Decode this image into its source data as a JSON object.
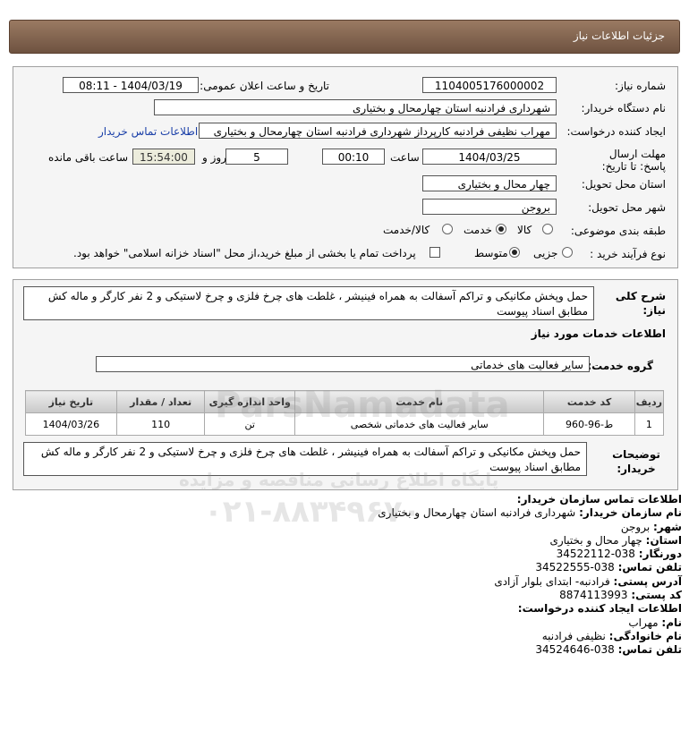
{
  "header": {
    "title": "جزئیات اطلاعات نیاز"
  },
  "form": {
    "need_number_label": "شماره نیاز:",
    "need_number": "1104005176000002",
    "announce_label": "تاریخ و ساعت اعلان عمومی:",
    "announce_value": "1404/03/19 - 08:11",
    "buyer_org_label": "نام دستگاه خریدار:",
    "buyer_org": "شهرداری فرادنبه استان چهارمحال و بختیاری",
    "creator_label": "ایجاد کننده درخواست:",
    "creator": "مهراب نظیفی فرادنبه کارپرداز شهرداری فرادنبه استان چهارمحال و بختیاری",
    "buyer_contact_link": "اطلاعات تماس خریدار",
    "deadline_label": "مهلت ارسال پاسخ: تا تاریخ:",
    "deadline_date": "1404/03/25",
    "time_label": "ساعت",
    "deadline_time": "00:10",
    "days_value": "5",
    "days_label": "روز و",
    "remaining_time": "15:54:00",
    "remaining_label": "ساعت باقی مانده",
    "province_label": "استان محل تحویل:",
    "province": "چهار محال و بختیاری",
    "city_label": "شهر محل تحویل:",
    "city": "بروجن",
    "category_label": "طبقه بندی موضوعی:",
    "category_options": [
      "کالا",
      "خدمت",
      "کالا/خدمت"
    ],
    "process_label": "نوع فرآیند خرید :",
    "process_options": [
      "جزیی",
      "متوسط"
    ],
    "payment_note": "پرداخت تمام یا بخشی از مبلغ خرید،از محل \"اسناد خزانه اسلامی\" خواهد بود."
  },
  "description": {
    "label": "شرح کلی نیاز:",
    "text": "حمل وپخش مکانیکی و تراکم آسفالت به همراه فینیشر ، غلطت های چرخ فلزی و چرخ لاستیکی و 2 نفر کارگر و ماله کش مطابق اسناد پیوست"
  },
  "services": {
    "section_title": "اطلاعات خدمات مورد نیاز",
    "group_label": "گروه خدمت:",
    "group_value": "سایر فعالیت های خدماتی",
    "columns": [
      "ردیف",
      "کد خدمت",
      "نام خدمت",
      "واحد اندازه گیری",
      "تعداد / مقدار",
      "تاریخ نیاز"
    ],
    "rows": [
      [
        "1",
        "ط-96-960",
        "سایر فعالیت های خدماتی شخصی",
        "تن",
        "110",
        "1404/03/26"
      ]
    ]
  },
  "buyer_notes": {
    "label": "توضیحات خریدار:",
    "text": "حمل وپخش مکانیکی و تراکم آسفالت به همراه فینیشر ، غلطت های چرخ فلزی و چرخ لاستیکی و 2 نفر کارگر و ماله کش مطابق اسناد پیوست"
  },
  "contact": {
    "org_title": "اطلاعات تماس سازمان خریدار:",
    "org_name_label": "نام سازمان خریدار:",
    "org_name": "شهرداری فرادنبه استان چهارمحال و بختیاری",
    "city_label": "شهر:",
    "city": "بروجن",
    "province_label": "استان:",
    "province": "چهار محال و بختیاری",
    "fax_label": "دورنگار:",
    "fax": "038-34522112",
    "phone_label": "تلفن تماس:",
    "phone": "038-34522555",
    "address_label": "آدرس پستی:",
    "address": "فرادنبه- ابتدای بلوار آزادی",
    "postal_label": "کد پستی:",
    "postal": "8874113993",
    "creator_title": "اطلاعات ایجاد کننده درخواست:",
    "first_name_label": "نام:",
    "first_name": "مهراب",
    "last_name_label": "نام خانوادگی:",
    "last_name": "نظیفی فرادنبه",
    "creator_phone_label": "تلفن تماس:",
    "creator_phone": "038-34524646"
  },
  "watermark": {
    "brand": "ParsNamadata",
    "tagline": "پایگاه اطلاع رسانی مناقصه و مزایده",
    "phone": "۰۲۱-۸۸۳۴۹۶۷۰"
  }
}
